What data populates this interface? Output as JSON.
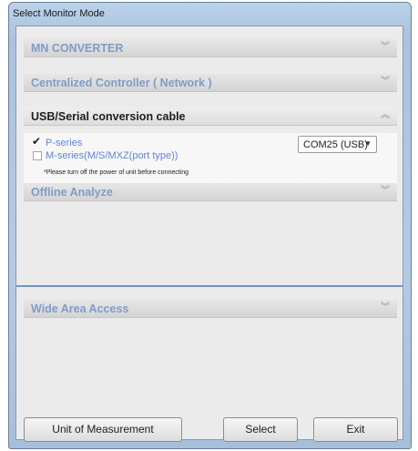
{
  "window": {
    "title": "Select Monitor Mode"
  },
  "sections": {
    "mn_converter": "MN CONVERTER",
    "centralized": "Centralized Controller ( Network )",
    "usb_serial": "USB/Serial conversion cable",
    "offline": "Offline Analyze",
    "wide_area": "Wide Area Access"
  },
  "usb_options": [
    {
      "label": "P-series",
      "checked": true
    },
    {
      "label": "M-series(M/S/MXZ(port type))",
      "checked": false
    }
  ],
  "port_select": {
    "value": "COM25 (USB)"
  },
  "note": "*Please turn off the power of unit before connecting",
  "buttons": {
    "unit": "Unit of Measurement",
    "select": "Select",
    "exit": "Exit"
  },
  "icons": {
    "expand": "double-chevron-down-icon",
    "collapse": "double-chevron-up-icon",
    "dropdown": "triangle-down-icon",
    "check": "checkmark-icon"
  }
}
